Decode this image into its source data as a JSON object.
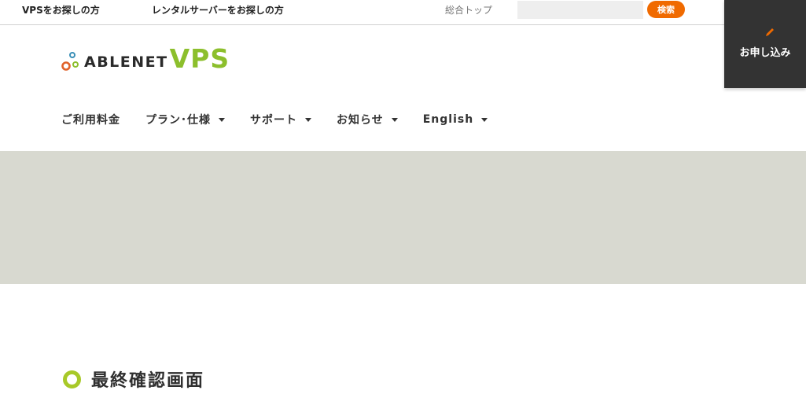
{
  "topbar": {
    "link_vps": "VPSをお探しの方",
    "link_rental": "レンタルサーバーをお探しの方",
    "link_top": "総合トップ",
    "search_value": "",
    "search_placeholder": "",
    "search_button": "検索"
  },
  "apply_button": {
    "icon": "pencil-icon",
    "label": "お申し込み"
  },
  "logo": {
    "brand": "ABLENET",
    "product": "VPS"
  },
  "nav": {
    "items": [
      {
        "label": "ご利用料金",
        "has_dropdown": false
      },
      {
        "label": "プラン･仕様",
        "has_dropdown": true
      },
      {
        "label": "サポート",
        "has_dropdown": true
      },
      {
        "label": "お知らせ",
        "has_dropdown": true
      },
      {
        "label": "English",
        "has_dropdown": true
      }
    ]
  },
  "page": {
    "heading": "最終確認画面"
  },
  "colors": {
    "accent_orange": "#f06a00",
    "brand_green": "#8cbf2c",
    "ring_green": "#a8c929",
    "apply_bg": "#333333",
    "banner_bg": "#d8d9d0"
  }
}
